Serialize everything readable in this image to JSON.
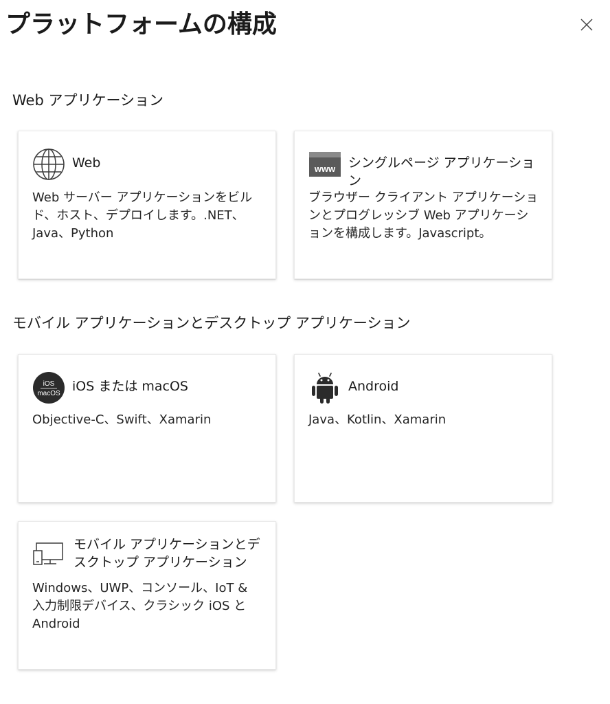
{
  "panel": {
    "title": "プラットフォームの構成",
    "close_icon": "close-icon"
  },
  "sections": [
    {
      "heading": "Web アプリケーション",
      "cards": [
        {
          "icon": "globe-icon",
          "title": "Web",
          "description": "Web サーバー アプリケーションをビルド、ホスト、デプロイします。.NET、Java、Python"
        },
        {
          "icon": "www-icon",
          "title": "シングルページ アプリケーション",
          "description": "ブラウザー クライアント アプリケーションとプログレッシブ Web アプリケーションを構成します。Javascript。"
        }
      ]
    },
    {
      "heading": "モバイル アプリケーションとデスクトップ アプリケーション",
      "cards": [
        {
          "icon": "ios-macos-icon",
          "title": "iOS または macOS",
          "description": "Objective-C、Swift、Xamarin",
          "icon_text": {
            "line1": "iOS",
            "line2": "macOS"
          }
        },
        {
          "icon": "android-icon",
          "title": "Android",
          "description": "Java、Kotlin、Xamarin"
        },
        {
          "icon": "desktop-icon",
          "title": "モバイル アプリケーションとデスクトップ アプリケーション",
          "description": "Windows、UWP、コンソール、IoT & 入力制限デバイス、クラシック iOS と Android"
        }
      ]
    }
  ],
  "colors": {
    "icon_gray": "#3b3b3b",
    "icon_dark": "#2b2b2b",
    "card_border": "#eaeaea"
  }
}
